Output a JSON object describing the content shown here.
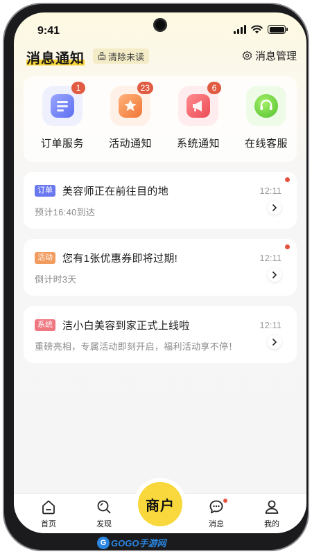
{
  "status_bar": {
    "time": "9:41"
  },
  "header": {
    "title": "消息通知",
    "clear_unread": "清除未读",
    "manage": "消息管理"
  },
  "categories": [
    {
      "label": "订单服务",
      "badge": "1",
      "icon": "order-icon",
      "color": "#6f7cf2"
    },
    {
      "label": "活动通知",
      "badge": "23",
      "icon": "star-icon",
      "color": "#f4894a"
    },
    {
      "label": "系统通知",
      "badge": "6",
      "icon": "megaphone-icon",
      "color": "#ef5d64"
    },
    {
      "label": "在线客服",
      "badge": "",
      "icon": "headset-icon",
      "color": "#62cf38"
    }
  ],
  "messages": [
    {
      "tag": "订单",
      "tag_color": "#6a78f0",
      "title": "美容师正在前往目的地",
      "subtitle": "预计16:40到达",
      "time": "12:11",
      "unread": true
    },
    {
      "tag": "活动",
      "tag_color": "#f19b5e",
      "title": "您有1张优惠券即将过期!",
      "subtitle": "倒计时3天",
      "time": "12:11",
      "unread": true
    },
    {
      "tag": "系统",
      "tag_color": "#ee7780",
      "title": "洁小白美容到家正式上线啦",
      "subtitle": "重磅亮相，专属活动即刻开启，福利活动享不停！",
      "time": "12:11",
      "unread": false
    }
  ],
  "tab_bar": {
    "items": [
      {
        "label": "首页",
        "icon": "home-icon"
      },
      {
        "label": "发现",
        "icon": "search-icon"
      },
      {
        "label": "消息",
        "icon": "chat-icon"
      },
      {
        "label": "我的",
        "icon": "user-icon"
      }
    ],
    "center_label": "商户"
  },
  "watermark": {
    "logo": "G",
    "text": "GOGO手游网"
  }
}
